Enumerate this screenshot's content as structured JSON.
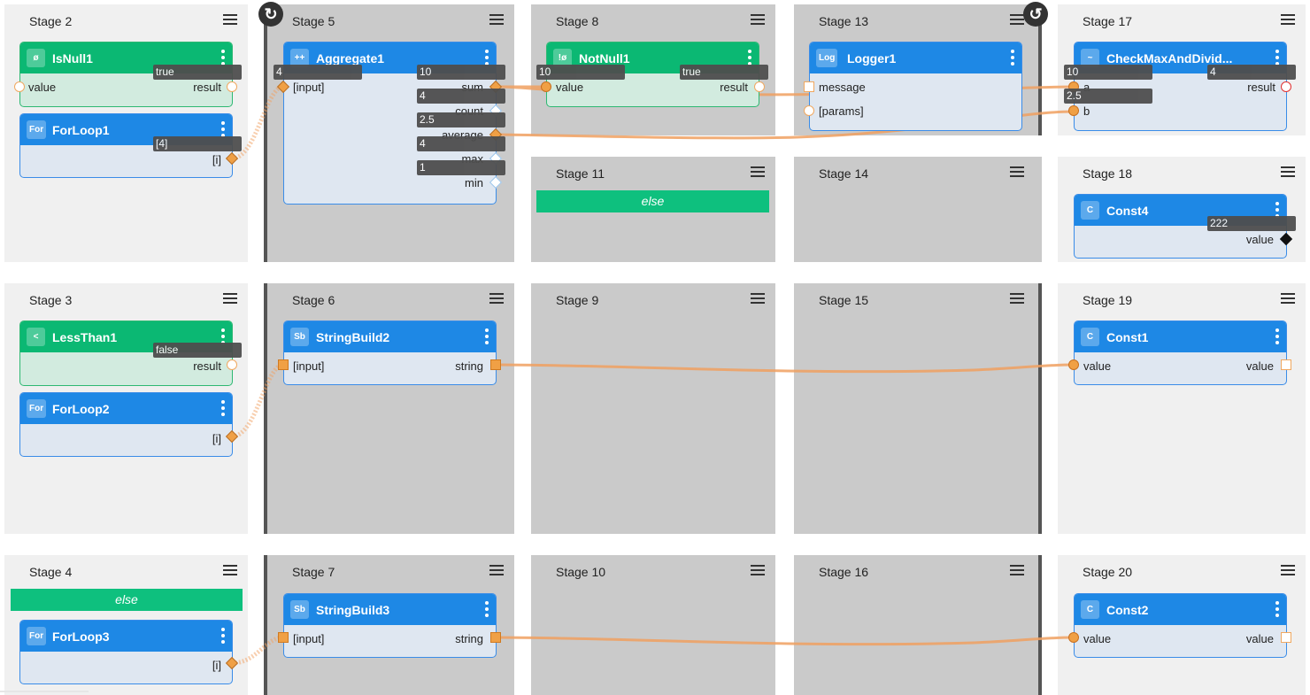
{
  "stages": {
    "s2": "Stage 2",
    "s3": "Stage 3",
    "s4": "Stage 4",
    "s5": "Stage 5",
    "s6": "Stage 6",
    "s7": "Stage 7",
    "s8": "Stage 8",
    "s9": "Stage 9",
    "s10": "Stage 10",
    "s11": "Stage 11",
    "s13": "Stage 13",
    "s14": "Stage 14",
    "s15": "Stage 15",
    "s16": "Stage 16",
    "s17": "Stage 17",
    "s18": "Stage 18",
    "s19": "Stage 19",
    "s20": "Stage 20"
  },
  "else_label": "else",
  "icons": {
    "loop_start": "↻",
    "loop_end": "↺"
  },
  "nodes": {
    "isnull1": {
      "badge": "ø",
      "name": "IsNull1",
      "in": "value",
      "out": "result",
      "out_value": "true"
    },
    "forloop1": {
      "badge": "For",
      "name": "ForLoop1",
      "out": "[i]",
      "out_value": "[4]"
    },
    "lessthan1": {
      "badge": "<",
      "name": "LessThan1",
      "out": "result",
      "out_value": "false"
    },
    "forloop2": {
      "badge": "For",
      "name": "ForLoop2",
      "out": "[i]"
    },
    "forloop3": {
      "badge": "For",
      "name": "ForLoop3",
      "out": "[i]"
    },
    "aggregate1": {
      "badge": "++",
      "name": "Aggregate1",
      "in": "[input]",
      "in_value": "4",
      "outs": [
        {
          "label": "sum",
          "value": "10"
        },
        {
          "label": "count",
          "value": "4"
        },
        {
          "label": "average",
          "value": "2.5"
        },
        {
          "label": "max",
          "value": "4"
        },
        {
          "label": "min",
          "value": "1"
        }
      ]
    },
    "stringbuild2": {
      "badge": "Sb",
      "name": "StringBuild2",
      "in": "[input]",
      "out": "string"
    },
    "stringbuild3": {
      "badge": "Sb",
      "name": "StringBuild3",
      "in": "[input]",
      "out": "string"
    },
    "notnull1": {
      "badge": "!ø",
      "name": "NotNull1",
      "in": "value",
      "in_value": "10",
      "out": "result",
      "out_value": "true"
    },
    "logger1": {
      "badge": "Log",
      "name": "Logger1",
      "in1": "message",
      "in2": "[params]"
    },
    "checkmax": {
      "badge": "~",
      "name": "CheckMaxAndDivid...",
      "in1": "a",
      "in1_value": "10",
      "in2": "b",
      "in2_value": "2.5",
      "out": "result",
      "out_value": "4"
    },
    "const4": {
      "badge": "C",
      "name": "Const4",
      "out": "value",
      "out_value": "222"
    },
    "const1": {
      "badge": "C",
      "name": "Const1",
      "in": "value",
      "out": "value"
    },
    "const2": {
      "badge": "C",
      "name": "Const2",
      "in": "value",
      "out": "value"
    }
  },
  "colors": {
    "wire": "#f0a060",
    "node_blue": "#1e88e5",
    "node_green": "#0bb873",
    "else_green": "#0ec07e"
  }
}
